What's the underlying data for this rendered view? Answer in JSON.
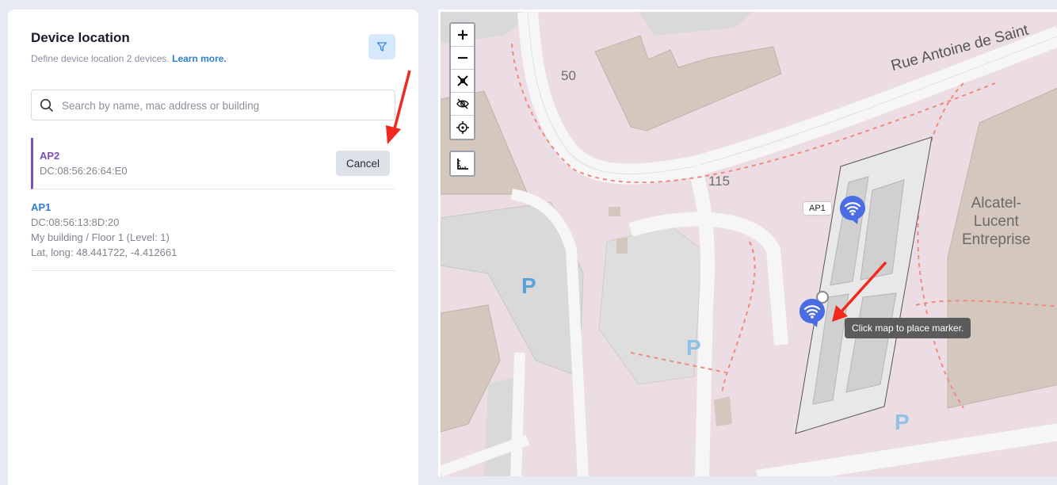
{
  "panel": {
    "title": "Device location",
    "subtitle": "Define device location 2 devices.",
    "learn_more": "Learn more.",
    "search_placeholder": "Search by name, mac address or building"
  },
  "devices": [
    {
      "name": "AP2",
      "mac": "DC:08:56:26:64:E0",
      "action": "Cancel",
      "name_color": "#7d4cc0"
    },
    {
      "name": "AP1",
      "mac": "DC:08:56:13:8D:20",
      "location": "My building / Floor 1 (Level: 1)",
      "coords": "Lat, long: 48.441722, -4.412661",
      "name_color": "#2f7fd6"
    }
  ],
  "map": {
    "labels": [
      "50",
      "115"
    ],
    "street": "Rue Antoine de Saint",
    "company": [
      "Alcatel-",
      "Lucent",
      "Entreprise"
    ],
    "parking": "P",
    "ap_tag": "AP1",
    "tooltip": "Click map to place marker.",
    "controls": [
      "zoom-in",
      "zoom-out",
      "fit",
      "hide",
      "locate",
      "ruler"
    ]
  },
  "colors": {
    "accent": "#2f7fd6",
    "ap2": "#7d4cc0",
    "marker": "#4b6ce2",
    "arrow": "#f0281e"
  }
}
